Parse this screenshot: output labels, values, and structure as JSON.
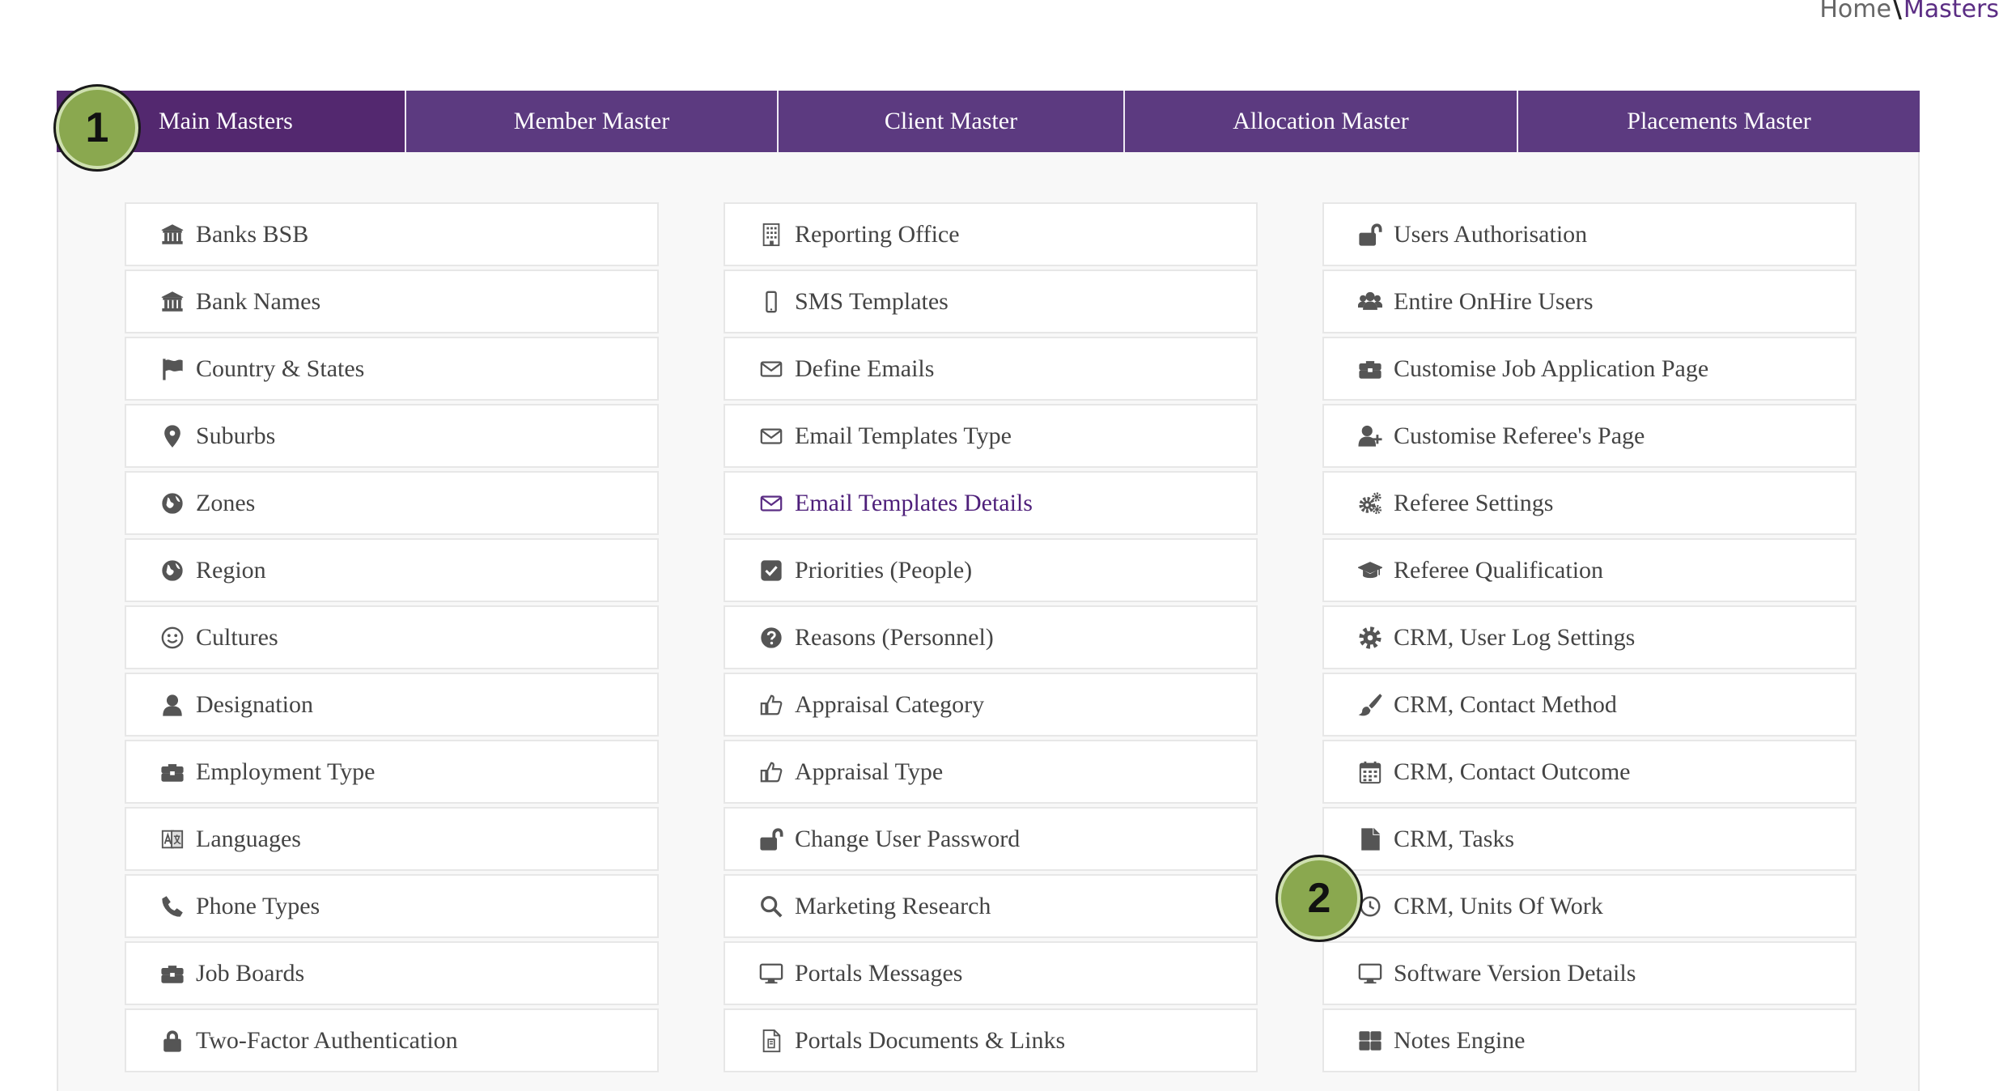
{
  "breadcrumb": {
    "home": "Home",
    "separator": "\\",
    "current": "Masters"
  },
  "tabs": [
    {
      "label": "Main Masters",
      "active": true
    },
    {
      "label": "Member Master"
    },
    {
      "label": "Client Master"
    },
    {
      "label": "Allocation Master"
    },
    {
      "label": "Placements Master"
    }
  ],
  "columns": [
    {
      "items": [
        {
          "label": "Banks BSB",
          "icon": "bank-icon"
        },
        {
          "label": "Bank Names",
          "icon": "bank-icon"
        },
        {
          "label": "Country & States",
          "icon": "flag-icon"
        },
        {
          "label": "Suburbs",
          "icon": "map-marker-icon"
        },
        {
          "label": "Zones",
          "icon": "globe-icon"
        },
        {
          "label": "Region",
          "icon": "globe-icon"
        },
        {
          "label": "Cultures",
          "icon": "smile-icon"
        },
        {
          "label": "Designation",
          "icon": "user-icon"
        },
        {
          "label": "Employment Type",
          "icon": "briefcase-icon"
        },
        {
          "label": "Languages",
          "icon": "language-icon"
        },
        {
          "label": "Phone Types",
          "icon": "phone-icon"
        },
        {
          "label": "Job Boards",
          "icon": "briefcase-icon"
        },
        {
          "label": "Two-Factor Authentication",
          "icon": "lock-icon"
        }
      ]
    },
    {
      "items": [
        {
          "label": "Reporting Office",
          "icon": "building-icon"
        },
        {
          "label": "SMS Templates",
          "icon": "mobile-icon"
        },
        {
          "label": "Define Emails",
          "icon": "envelope-icon"
        },
        {
          "label": "Email Templates Type",
          "icon": "envelope-icon"
        },
        {
          "label": "Email Templates Details",
          "icon": "envelope-icon",
          "highlight": true
        },
        {
          "label": "Priorities (People)",
          "icon": "check-square-icon"
        },
        {
          "label": "Reasons (Personnel)",
          "icon": "question-circle-icon"
        },
        {
          "label": "Appraisal Category",
          "icon": "thumbs-up-icon"
        },
        {
          "label": "Appraisal Type",
          "icon": "thumbs-up-icon"
        },
        {
          "label": "Change User Password",
          "icon": "unlock-icon"
        },
        {
          "label": "Marketing Research",
          "icon": "search-icon"
        },
        {
          "label": "Portals Messages",
          "icon": "desktop-icon"
        },
        {
          "label": "Portals Documents & Links",
          "icon": "document-icon"
        }
      ]
    },
    {
      "items": [
        {
          "label": "Users Authorisation",
          "icon": "unlock-icon"
        },
        {
          "label": "Entire OnHire Users",
          "icon": "users-icon"
        },
        {
          "label": "Customise Job Application Page",
          "icon": "briefcase-icon"
        },
        {
          "label": "Customise Referee's Page",
          "icon": "user-plus-icon"
        },
        {
          "label": "Referee Settings",
          "icon": "cogs-icon"
        },
        {
          "label": "Referee Qualification",
          "icon": "graduation-cap-icon"
        },
        {
          "label": "CRM, User Log Settings",
          "icon": "gear-icon"
        },
        {
          "label": "CRM, Contact Method",
          "icon": "paint-brush-icon"
        },
        {
          "label": "CRM, Contact Outcome",
          "icon": "calendar-icon"
        },
        {
          "label": "CRM, Tasks",
          "icon": "file-icon"
        },
        {
          "label": "CRM, Units Of Work",
          "icon": "clock-icon"
        },
        {
          "label": "Software Version Details",
          "icon": "desktop-icon"
        },
        {
          "label": "Notes Engine",
          "icon": "th-large-icon"
        }
      ]
    }
  ],
  "markers": [
    {
      "label": "1"
    },
    {
      "label": "2"
    }
  ]
}
